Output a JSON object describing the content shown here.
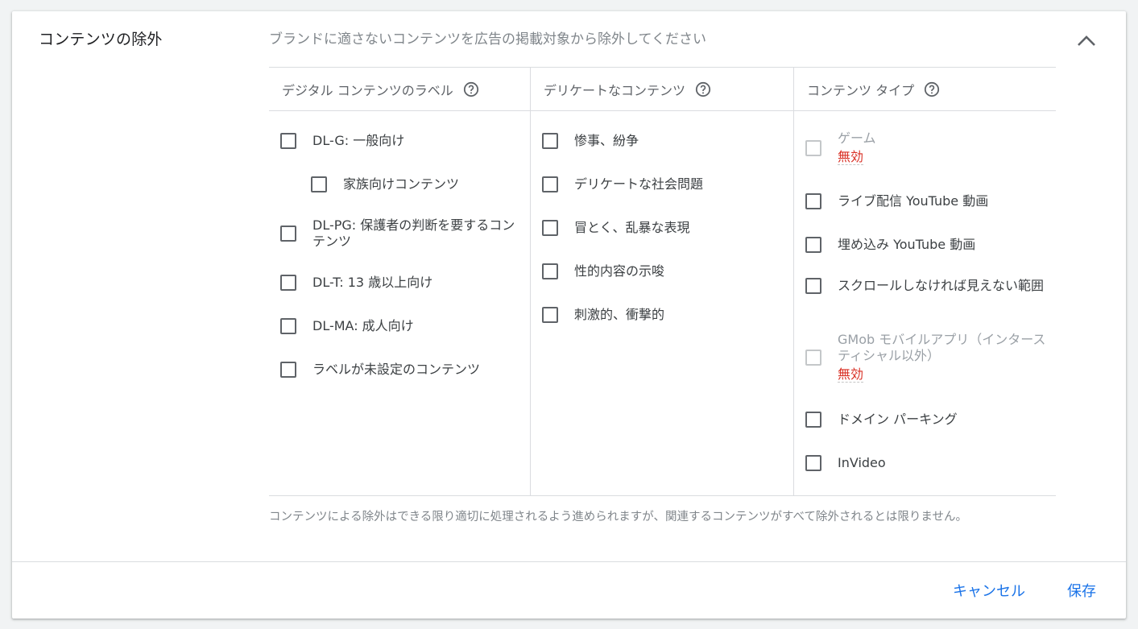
{
  "section": {
    "title": "コンテンツの除外",
    "subtitle": "ブランドに適さないコンテンツを広告の掲載対象から除外してください"
  },
  "columns": [
    {
      "header": "デジタル コンテンツのラベル",
      "options": [
        {
          "label": "DL-G: 一般向け",
          "checked": false
        },
        {
          "label": "家族向けコンテンツ",
          "checked": false
        },
        {
          "label": "DL-PG: 保護者の判断を要するコンテンツ",
          "checked": false
        },
        {
          "label": "DL-T: 13 歳以上向け",
          "checked": false
        },
        {
          "label": "DL-MA: 成人向け",
          "checked": false
        },
        {
          "label": "ラベルが未設定のコンテンツ",
          "checked": false
        }
      ]
    },
    {
      "header": "デリケートなコンテンツ",
      "options": [
        {
          "label": "惨事、紛争",
          "checked": false
        },
        {
          "label": "デリケートな社会問題",
          "checked": false
        },
        {
          "label": "冒とく、乱暴な表現",
          "checked": false
        },
        {
          "label": "性的内容の示唆",
          "checked": false
        },
        {
          "label": "刺激的、衝撃的",
          "checked": false
        }
      ]
    },
    {
      "header": "コンテンツ タイプ",
      "options": [
        {
          "label": "ゲーム",
          "checked": false,
          "disabled": true,
          "status": "無効"
        },
        {
          "label": "ライブ配信 YouTube 動画",
          "checked": false
        },
        {
          "label": "埋め込み YouTube 動画",
          "checked": false
        },
        {
          "label": "スクロールしなければ見えない範囲",
          "checked": false
        },
        {
          "label": "GMob モバイルアプリ（インタースティシャル以外）",
          "checked": false,
          "disabled": true,
          "status": "無効"
        },
        {
          "label": "ドメイン パーキング",
          "checked": false
        },
        {
          "label": "InVideo",
          "checked": false
        }
      ]
    }
  ],
  "footnote": "コンテンツによる除外はできる限り適切に処理されるよう進められますが、関連するコンテンツがすべて除外されるとは限りません。",
  "actions": {
    "cancel": "キャンセル",
    "save": "保存"
  },
  "colors": {
    "accent": "#1a73e8",
    "error": "#d93025"
  }
}
